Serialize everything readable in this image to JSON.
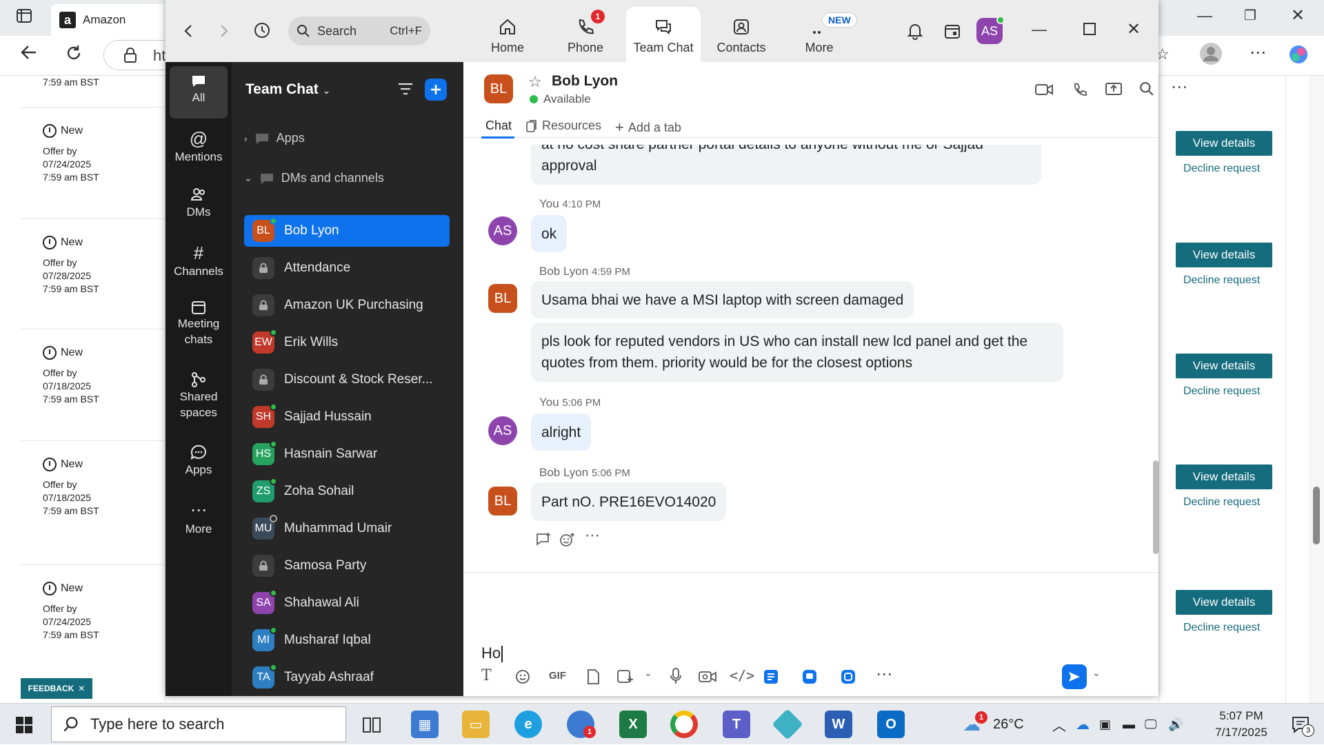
{
  "browser": {
    "tab_title": "Amazon",
    "url_fragment": "ht"
  },
  "background_page": {
    "rows": [
      {
        "status": "",
        "offer_label": "",
        "date": "",
        "time": "7:59 am BST"
      },
      {
        "status": "New",
        "offer_label": "Offer by",
        "date": "07/24/2025",
        "time": "7:59 am BST"
      },
      {
        "status": "New",
        "offer_label": "Offer by",
        "date": "07/28/2025",
        "time": "7:59 am BST"
      },
      {
        "status": "New",
        "offer_label": "Offer by",
        "date": "07/18/2025",
        "time": "7:59 am BST"
      },
      {
        "status": "New",
        "offer_label": "Offer by",
        "date": "07/18/2025",
        "time": "7:59 am BST"
      },
      {
        "status": "New",
        "offer_label": "Offer by",
        "date": "07/24/2025",
        "time": "7:59 am BST"
      }
    ],
    "view_details_label": "View details",
    "decline_label": "Decline request",
    "feedback_label": "FEEDBACK"
  },
  "zoom": {
    "search_placeholder": "Search",
    "search_shortcut": "Ctrl+F",
    "nav": [
      {
        "label": "Home",
        "icon": "home-icon"
      },
      {
        "label": "Phone",
        "icon": "phone-icon",
        "badge": "1"
      },
      {
        "label": "Team Chat",
        "icon": "chat-icon",
        "active": true
      },
      {
        "label": "Contacts",
        "icon": "contacts-icon"
      },
      {
        "label": "More",
        "icon": "more-icon",
        "badge_text": "NEW"
      }
    ],
    "user_initials": "AS",
    "rail": [
      {
        "label": "All",
        "icon": "chat-bubble-icon"
      },
      {
        "label": "Mentions",
        "icon": "at-icon"
      },
      {
        "label": "DMs",
        "icon": "people-icon"
      },
      {
        "label": "Channels",
        "icon": "hash-icon"
      },
      {
        "label": "Meeting chats",
        "icon": "calendar-icon"
      },
      {
        "label": "Shared spaces",
        "icon": "shared-icon"
      },
      {
        "label": "Apps",
        "icon": "apps-icon"
      },
      {
        "label": "More",
        "icon": "ellipsis-icon"
      }
    ],
    "panel_title": "Team Chat",
    "sections": {
      "apps": "Apps",
      "dms": "DMs and channels"
    },
    "channels": [
      {
        "name": "Bob Lyon",
        "initials": "BL",
        "color": "#c8501c",
        "online": true,
        "active": true
      },
      {
        "name": "Attendance",
        "lock": true
      },
      {
        "name": "Amazon UK Purchasing",
        "lock": true
      },
      {
        "name": "Erik Wills",
        "initials": "EW",
        "color": "#c0392b",
        "online": true
      },
      {
        "name": "Discount & Stock Reser...",
        "lock": true
      },
      {
        "name": "Sajjad Hussain",
        "initials": "SH",
        "color": "#c0392b",
        "online": true
      },
      {
        "name": "Hasnain Sarwar",
        "initials": "HS",
        "color": "#27a360",
        "online": true
      },
      {
        "name": "Zoha Sohail",
        "initials": "ZS",
        "color": "#1f9d6e",
        "online": true
      },
      {
        "name": "Muhammad Umair",
        "initials": "MU",
        "color": "#3b4a5a",
        "away": true
      },
      {
        "name": "Samosa Party",
        "lock": true
      },
      {
        "name": "Shahawal Ali",
        "initials": "SA",
        "color": "#8e44ad",
        "online": true
      },
      {
        "name": "Musharaf Iqbal",
        "initials": "MI",
        "color": "#2d7fc1",
        "online": true
      },
      {
        "name": "Tayyab Ashraaf",
        "initials": "TA",
        "color": "#2d7fc1",
        "online": true
      }
    ],
    "chat": {
      "contact_name": "Bob Lyon",
      "contact_initials": "BL",
      "contact_status": "Available",
      "tabs": {
        "chat": "Chat",
        "resources": "Resources",
        "add": "Add a tab"
      },
      "messages": [
        {
          "sender": "",
          "time": "",
          "text": "approval",
          "partial_prev": "at no cost share partner portal details to anyone without me or Sajjad"
        },
        {
          "sender": "You",
          "time": "4:10 PM",
          "text": "ok",
          "initials": "AS"
        },
        {
          "sender": "Bob Lyon",
          "time": "4:59 PM",
          "text": "Usama bhai we have a MSI laptop with screen damaged",
          "initials": "BL"
        },
        {
          "sender": "",
          "time": "",
          "text": "pls look for reputed vendors in US who can install new lcd panel and get the quotes from them. priority would be for the closest options"
        },
        {
          "sender": "You",
          "time": "5:06 PM",
          "text": "alright",
          "initials": "AS"
        },
        {
          "sender": "Bob Lyon",
          "time": "5:06 PM",
          "text": "Part nO. PRE16EVO14020",
          "initials": "BL"
        }
      ],
      "compose_text": "Ho"
    },
    "colors": {
      "accent": "#0e72ed",
      "bob_avatar": "#c8501c",
      "you_avatar": "#8e44ad"
    }
  },
  "taskbar": {
    "search_placeholder": "Type here to search",
    "zoom_badge": "1",
    "temperature": "26°C",
    "weather_badge": "1",
    "time": "5:07 PM",
    "date": "7/17/2025",
    "notification_count": "3"
  }
}
